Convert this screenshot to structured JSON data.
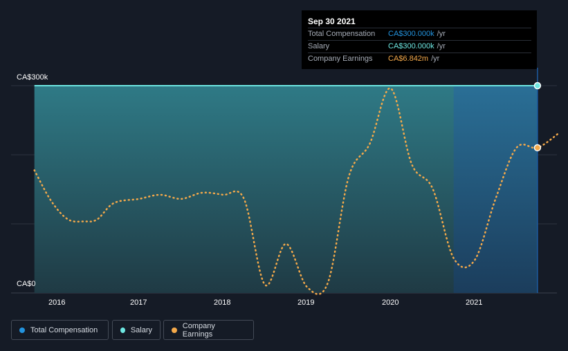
{
  "chart_data": {
    "type": "line",
    "y_ticks": [
      "CA$0",
      "CA$300k"
    ],
    "x_ticks": [
      "2016",
      "2017",
      "2018",
      "2019",
      "2020",
      "2021"
    ],
    "ylim": [
      0,
      300
    ],
    "xlim": [
      2015.0,
      2022.0
    ],
    "grid": true,
    "legend_position": "bottom-left",
    "series": [
      {
        "name": "Total Compensation",
        "color": "#2394df",
        "style": "area",
        "x": [
          2015.75,
          2021.75
        ],
        "y": [
          300,
          300
        ]
      },
      {
        "name": "Salary",
        "color": "#6ee7e2",
        "style": "line",
        "x": [
          2015.75,
          2021.75
        ],
        "y": [
          300,
          300
        ]
      },
      {
        "name": "Company Earnings",
        "color": "#f4a94a",
        "style": "dotted",
        "x": [
          2015.75,
          2015.95,
          2016.15,
          2016.35,
          2016.5,
          2016.7,
          2017.0,
          2017.25,
          2017.5,
          2017.75,
          2018.0,
          2018.25,
          2018.5,
          2018.75,
          2019.0,
          2019.25,
          2019.5,
          2019.75,
          2020.0,
          2020.25,
          2020.5,
          2020.75,
          2021.0,
          2021.25,
          2021.5,
          2021.75,
          2022.0
        ],
        "y": [
          6.0,
          4.5,
          3.6,
          3.5,
          3.6,
          4.4,
          4.6,
          4.8,
          4.6,
          4.9,
          4.8,
          4.6,
          0.4,
          2.4,
          0.3,
          0.5,
          5.7,
          7.3,
          10.0,
          6.3,
          5.1,
          1.7,
          1.6,
          4.6,
          7.1,
          7.1,
          7.8
        ]
      }
    ]
  },
  "tooltip": {
    "date": "Sep 30 2021",
    "rows": [
      {
        "label": "Total Compensation",
        "value": "CA$300.000k",
        "unit": "/yr",
        "color": "#2394df"
      },
      {
        "label": "Salary",
        "value": "CA$300.000k",
        "unit": "/yr",
        "color": "#6ee7e2"
      },
      {
        "label": "Company Earnings",
        "value": "CA$6.842m",
        "unit": "/yr",
        "color": "#f4a94a"
      }
    ]
  },
  "legend": [
    {
      "label": "Total Compensation",
      "color": "#2394df"
    },
    {
      "label": "Salary",
      "color": "#6ee7e2"
    },
    {
      "label": "Company Earnings",
      "color": "#f4a94a"
    }
  ]
}
